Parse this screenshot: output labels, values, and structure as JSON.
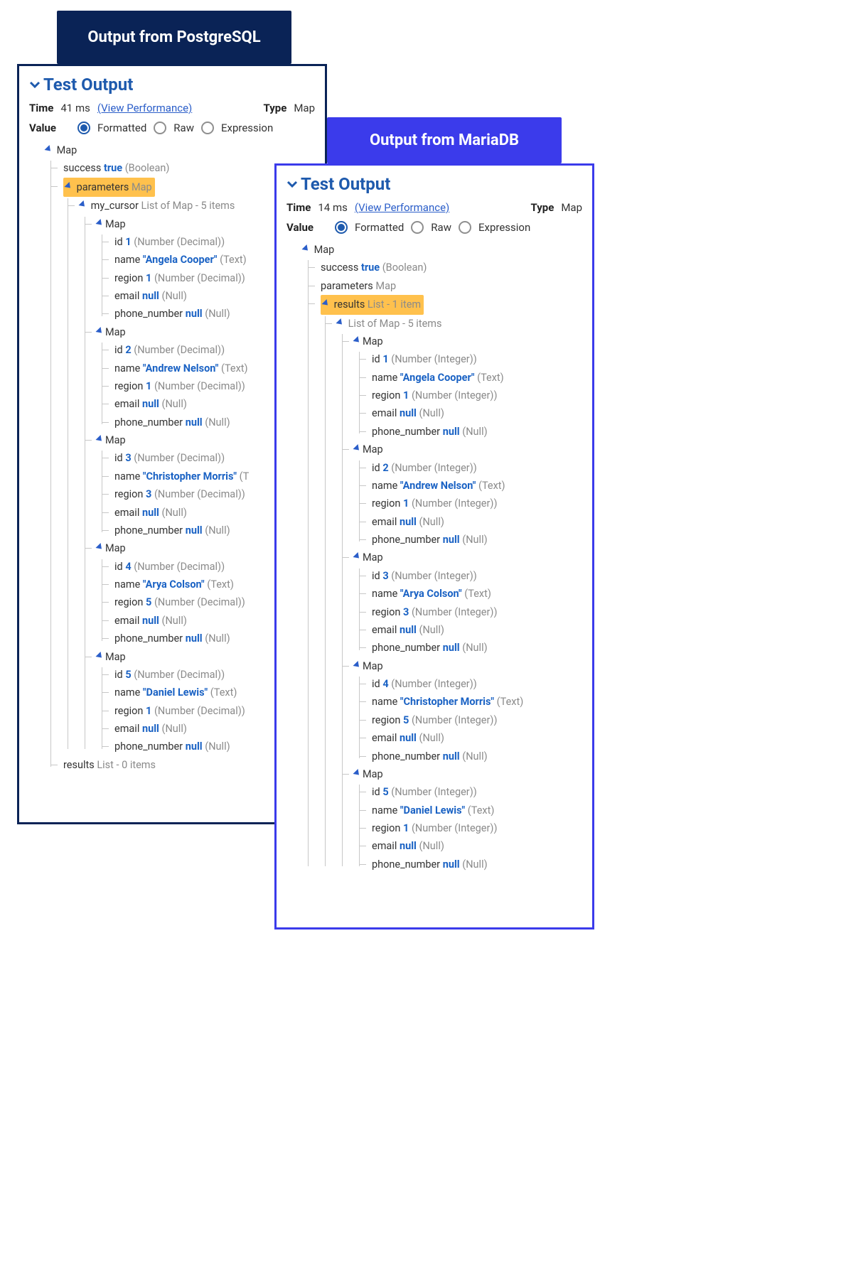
{
  "tabs": {
    "pg": "Output from PostgreSQL",
    "mb": "Output from MariaDB"
  },
  "pg": {
    "header": "Test Output",
    "timeLabel": "Time",
    "timeValue": "41 ms",
    "viewPerf": "(View Performance)",
    "typeLabel": "Type",
    "typeValue": "Map",
    "valueLabel": "Value",
    "radios": {
      "formatted": "Formatted",
      "raw": "Raw",
      "expression": "Expression"
    },
    "rootMap": "Map",
    "successKey": "success",
    "successVal": "true",
    "successType": "(Boolean)",
    "parametersKey": "parameters",
    "parametersType": "Map",
    "cursorKey": "my_cursor",
    "cursorType": "List of Map - 5 items",
    "numType": "(Number (Decimal))",
    "textType": "(Text)",
    "nullType": "(Null)",
    "nullVal": "null",
    "resultsKey": "results",
    "resultsType": "List - 0 items",
    "records": [
      {
        "id": "1",
        "name": "\"Angela Cooper\"",
        "region": "1"
      },
      {
        "id": "2",
        "name": "\"Andrew Nelson\"",
        "region": "1"
      },
      {
        "id": "3",
        "name": "\"Christopher Morris\"",
        "region": "3"
      },
      {
        "id": "4",
        "name": "\"Arya Colson\"",
        "region": "5"
      },
      {
        "id": "5",
        "name": "\"Daniel Lewis\"",
        "region": "1"
      }
    ]
  },
  "mb": {
    "header": "Test Output",
    "timeLabel": "Time",
    "timeValue": "14 ms",
    "viewPerf": "(View Performance)",
    "typeLabel": "Type",
    "typeValue": "Map",
    "valueLabel": "Value",
    "radios": {
      "formatted": "Formatted",
      "raw": "Raw",
      "expression": "Expression"
    },
    "rootMap": "Map",
    "successKey": "success",
    "successVal": "true",
    "successType": "(Boolean)",
    "parametersKey": "parameters",
    "parametersType": "Map",
    "resultsKey": "results",
    "resultsType": "List - 1 item",
    "listOfMap": "List of Map - 5 items",
    "numType": "(Number (Integer))",
    "textType": "(Text)",
    "nullType": "(Null)",
    "nullVal": "null",
    "records": [
      {
        "id": "1",
        "name": "\"Angela Cooper\"",
        "region": "1"
      },
      {
        "id": "2",
        "name": "\"Andrew Nelson\"",
        "region": "1"
      },
      {
        "id": "3",
        "name": "\"Arya Colson\"",
        "region": "3"
      },
      {
        "id": "4",
        "name": "\"Christopher Morris\"",
        "region": "5"
      },
      {
        "id": "5",
        "name": "\"Daniel Lewis\"",
        "region": "1"
      }
    ]
  },
  "fields": {
    "id": "id",
    "name": "name",
    "region": "region",
    "email": "email",
    "phone": "phone_number",
    "map": "Map"
  }
}
